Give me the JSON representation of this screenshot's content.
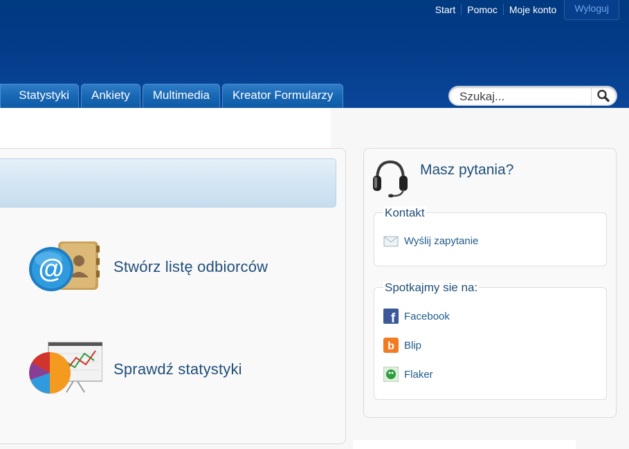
{
  "top_links": {
    "start": "Start",
    "help": "Pomoc",
    "account": "Moje konto",
    "logout": "Wyloguj"
  },
  "nav": {
    "tabs": [
      {
        "label": "Statystyki"
      },
      {
        "label": "Ankiety"
      },
      {
        "label": "Multimedia"
      },
      {
        "label": "Kreator Formularzy"
      }
    ]
  },
  "search": {
    "placeholder": "Szukaj..."
  },
  "main": {
    "actions": [
      {
        "label": "Stwórz listę odbiorców",
        "icon": "address-book-icon"
      },
      {
        "label": "Sprawdź statystyki",
        "icon": "statistics-chart-icon"
      }
    ]
  },
  "sidebar": {
    "title": "Masz pytania?",
    "contact": {
      "title": "Kontakt",
      "link": "Wyślij zapytanie"
    },
    "social": {
      "title": "Spotkajmy sie na:",
      "links": [
        {
          "label": "Facebook",
          "icon": "facebook-icon",
          "color": "#3b5998"
        },
        {
          "label": "Blip",
          "icon": "blip-icon",
          "color": "#f07b22"
        },
        {
          "label": "Flaker",
          "icon": "flaker-icon",
          "color": "#2e9e3e"
        }
      ]
    }
  },
  "colors": {
    "header": "#043b88",
    "tab": "#1867b4",
    "heading": "#1f4e79",
    "link": "#1f5b8a"
  }
}
